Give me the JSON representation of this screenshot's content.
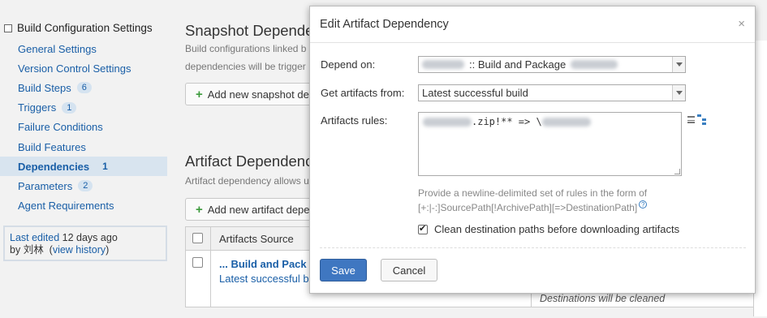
{
  "sidebar": {
    "header": "Build Configuration Settings",
    "items": [
      {
        "label": "General Settings",
        "badge": ""
      },
      {
        "label": "Version Control Settings",
        "badge": ""
      },
      {
        "label": "Build Steps",
        "badge": "6"
      },
      {
        "label": "Triggers",
        "badge": "1"
      },
      {
        "label": "Failure Conditions",
        "badge": ""
      },
      {
        "label": "Build Features",
        "badge": ""
      },
      {
        "label": "Dependencies",
        "badge": "1"
      },
      {
        "label": "Parameters",
        "badge": "2"
      },
      {
        "label": "Agent Requirements",
        "badge": ""
      }
    ],
    "last_edited_prefix": "Last edited",
    "last_edited_time": "12 days ago",
    "by_label": "by",
    "user": "刘林",
    "view_history": "view history"
  },
  "main": {
    "snapshot_title": "Snapshot Depende",
    "snapshot_desc_line1": "Build configurations linked b",
    "snapshot_desc_line2": "dependencies will be trigger",
    "add_snapshot_button": "Add new snapshot de",
    "artifact_title": "Artifact Dependenc",
    "artifact_desc": "Artifact dependency allows u",
    "add_artifact_button": "Add new artifact depe",
    "table": {
      "column_source": "Artifacts Source",
      "row_source_name": "... Build and Pack",
      "row_source_build": "Latest successful b",
      "row_right_text": "Destinations will be cleaned"
    }
  },
  "dialog": {
    "title": "Edit Artifact Dependency",
    "close": "×",
    "depend_on_label": "Depend on:",
    "depend_on_value": ":: Build and Package",
    "get_artifacts_label": "Get artifacts from:",
    "get_artifacts_value": "Latest successful build",
    "artifacts_rules_label": "Artifacts rules:",
    "artifacts_rules_value_mid": ".zip!** => \\",
    "hint_line1": "Provide a newline-delimited set of rules in the form of",
    "hint_line2": "[+:|-:]SourcePath[!ArchivePath][=>DestinationPath]",
    "hint_qmark": "?",
    "clean_label": "Clean destination paths before downloading artifacts",
    "save_button": "Save",
    "cancel_button": "Cancel"
  },
  "colors": {
    "link": "#1a5fa7",
    "primary_button": "#3f77c1",
    "active_item_bg": "#d8e4ef"
  }
}
